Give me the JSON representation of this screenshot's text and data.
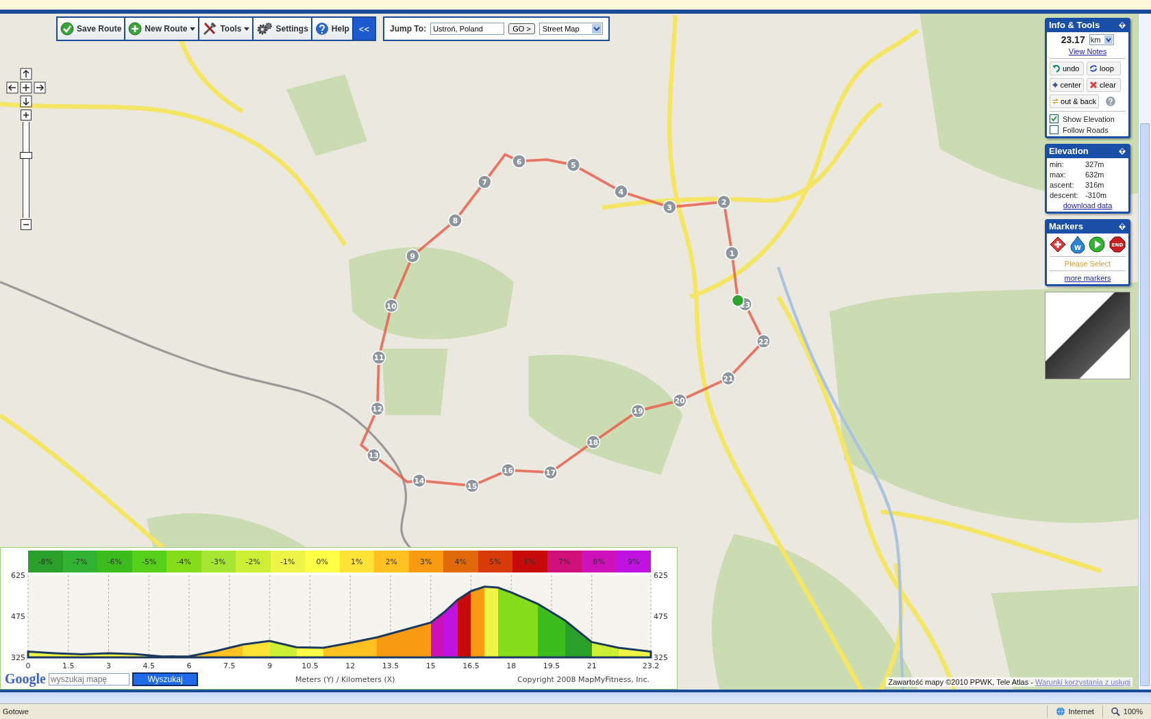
{
  "toolbar": {
    "buttons": [
      {
        "kind": "save",
        "label": "Save Route",
        "dropdown": false
      },
      {
        "kind": "new",
        "label": "New Route",
        "dropdown": true
      },
      {
        "kind": "tools",
        "label": "Tools",
        "dropdown": true
      },
      {
        "kind": "settings",
        "label": "Settings",
        "dropdown": false
      },
      {
        "kind": "help",
        "label": "Help",
        "dropdown": false
      }
    ],
    "collapse": "<<"
  },
  "jump_to": {
    "label": "Jump To:",
    "value": "Ustroń, Poland",
    "go": "GO >",
    "map_type": "Street Map"
  },
  "zoom_slider": {
    "level": 0.66
  },
  "route_markers": [
    "1",
    "2",
    "3",
    "4",
    "5",
    "6",
    "7",
    "8",
    "9",
    "10",
    "11",
    "12",
    "13",
    "14",
    "15",
    "16",
    "17",
    "18",
    "19",
    "20",
    "21",
    "22",
    "23"
  ],
  "info_tools": {
    "title": "Info & Tools",
    "distance": "23.17",
    "unit": "km",
    "view_notes": "View Notes",
    "buttons": [
      {
        "kind": "undo",
        "label": "undo"
      },
      {
        "kind": "loop",
        "label": "loop"
      },
      {
        "kind": "center",
        "label": "center"
      },
      {
        "kind": "clear",
        "label": "clear"
      },
      {
        "kind": "outback",
        "label": "out & back"
      }
    ],
    "options": [
      {
        "label": "Show Elevation",
        "checked": true
      },
      {
        "label": "Follow Roads",
        "checked": false
      }
    ]
  },
  "elevation": {
    "title": "Elevation",
    "rows": [
      {
        "label": "min:",
        "value": "327m"
      },
      {
        "label": "max:",
        "value": "632m"
      },
      {
        "label": "ascent:",
        "value": "316m"
      },
      {
        "label": "descent:",
        "value": "-310m"
      }
    ],
    "download": "download data"
  },
  "markers": {
    "title": "Markers",
    "icons": [
      {
        "kind": "plus"
      },
      {
        "kind": "water",
        "text": "W"
      },
      {
        "kind": "start"
      },
      {
        "kind": "end",
        "text": "END"
      }
    ],
    "prompt": "Please Select",
    "more": "more markers"
  },
  "elevation_profile": {
    "grade_legend": [
      {
        "label": "-8%",
        "color": "#2aa02a"
      },
      {
        "label": "-7%",
        "color": "#32b232"
      },
      {
        "label": "-6%",
        "color": "#3cbc1e"
      },
      {
        "label": "-5%",
        "color": "#56d01a"
      },
      {
        "label": "-4%",
        "color": "#84dc1a"
      },
      {
        "label": "-3%",
        "color": "#a6e632"
      },
      {
        "label": "-2%",
        "color": "#ccee34"
      },
      {
        "label": "-1%",
        "color": "#eef546"
      },
      {
        "label": "0%",
        "color": "#ffff48"
      },
      {
        "label": "1%",
        "color": "#ffe236"
      },
      {
        "label": "2%",
        "color": "#ffc022"
      },
      {
        "label": "3%",
        "color": "#f89a12"
      },
      {
        "label": "4%",
        "color": "#e06a0a"
      },
      {
        "label": "5%",
        "color": "#d83a0a"
      },
      {
        "label": "6%",
        "color": "#c80a0a"
      },
      {
        "label": "7%",
        "color": "#d0107a"
      },
      {
        "label": "8%",
        "color": "#cc12b8"
      },
      {
        "label": "9%",
        "color": "#c012e0"
      }
    ],
    "right_axis_labels": [
      "625",
      "475",
      "325"
    ],
    "chart_data": {
      "type": "area",
      "grid": true,
      "x": [
        0,
        1,
        2,
        3,
        4,
        5,
        6,
        7,
        8,
        9,
        10,
        11,
        12,
        13,
        14,
        15,
        15.5,
        16,
        16.5,
        17,
        17.5,
        18,
        19,
        20,
        21,
        22,
        23.2
      ],
      "series": [
        {
          "color": "#1c3a5e",
          "values": [
            346,
            340,
            336,
            340,
            337,
            328,
            329,
            348,
            372,
            385,
            362,
            360,
            378,
            398,
            425,
            452,
            490,
            535,
            567,
            583,
            580,
            562,
            520,
            460,
            381,
            360,
            346
          ]
        }
      ],
      "xlim": [
        0,
        23.2
      ],
      "ylim": [
        325,
        625
      ],
      "xticks": [
        0,
        1.5,
        3,
        4.5,
        6,
        7.5,
        9,
        10.5,
        12,
        13.5,
        15,
        16.5,
        18,
        19.5,
        21,
        {
          "value": 23.2,
          "label": "23.2"
        }
      ],
      "yticks": [
        325,
        475,
        625
      ]
    },
    "axis_caption": "Meters (Y) / Kilometers (X)",
    "copyright": "Copyright 2008 MapMyFitness, Inc."
  },
  "map_search": {
    "logo": "Google",
    "placeholder": "wyszukaj mapę",
    "button": "Wyszukaj"
  },
  "map_attribution": {
    "text": "Zawartość mapy ©2010 PPWK, Tele Atlas - ",
    "link": "Warunki korzystania z usługi"
  },
  "status_bar": {
    "status": "Gotowe",
    "zone": "Internet",
    "zoom": "100%"
  }
}
